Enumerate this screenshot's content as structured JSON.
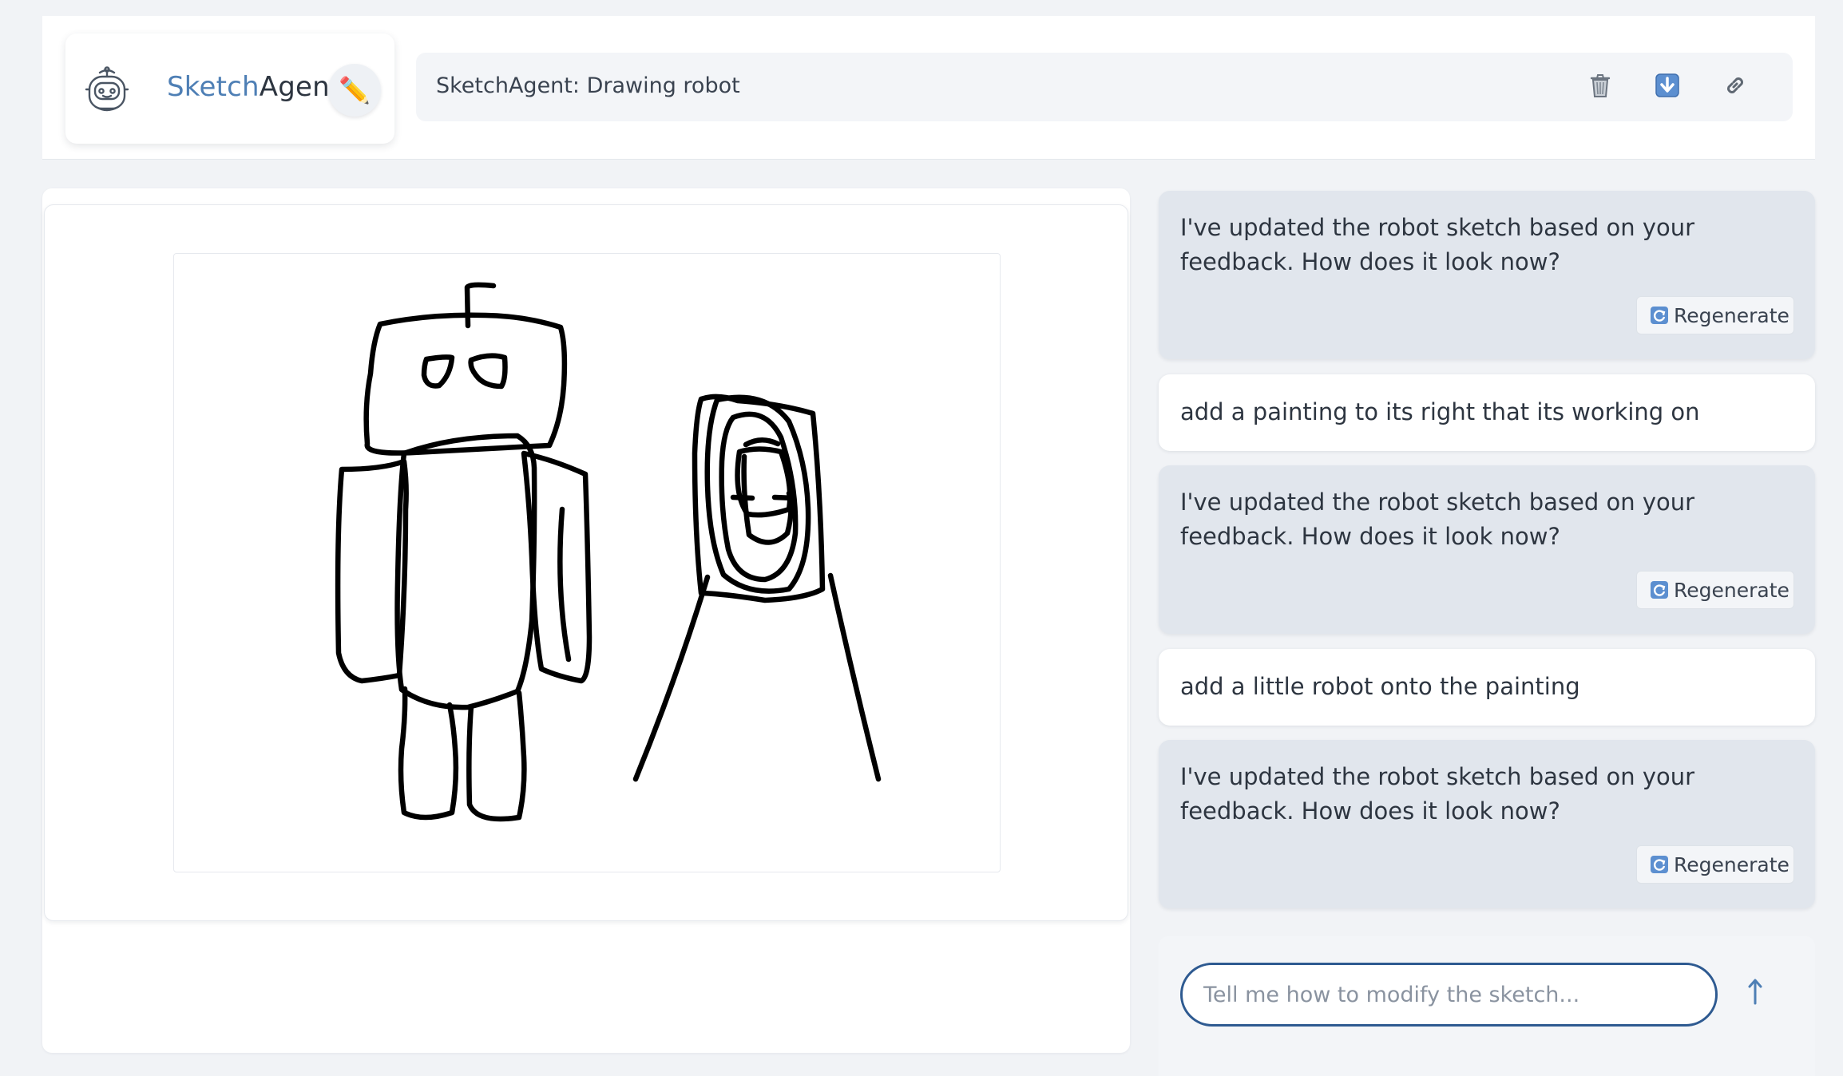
{
  "header": {
    "logo": {
      "part1": "Sketch",
      "part2": "Agent",
      "icon": "robot-icon"
    },
    "edit_icon": "pencil-icon",
    "title": "SketchAgent: Drawing robot",
    "tools": [
      {
        "name": "trash",
        "icon": "trash-icon"
      },
      {
        "name": "download",
        "icon": "download-icon"
      },
      {
        "name": "link",
        "icon": "link-icon"
      }
    ]
  },
  "canvas": {
    "content": "robot sketch with painting easel"
  },
  "chat": {
    "messages": [
      {
        "role": "agent",
        "text": "I've updated the robot sketch based on your feedback. How does it look now?",
        "regenerate_label": "Regenerate"
      },
      {
        "role": "user",
        "text": "add a painting to its right that its working on"
      },
      {
        "role": "agent",
        "text": "I've updated the robot sketch based on your feedback. How does it look now?",
        "regenerate_label": "Regenerate"
      },
      {
        "role": "user",
        "text": "add a little robot onto the painting"
      },
      {
        "role": "agent",
        "text": "I've updated the robot sketch based on your feedback. How does it look now?",
        "regenerate_label": "Regenerate"
      }
    ],
    "input": {
      "placeholder": "Tell me how to modify the sketch...",
      "value": ""
    },
    "send_icon": "arrow-up-icon"
  },
  "colors": {
    "brand_blue": "#4e7fb5",
    "input_border": "#2e5a91",
    "agent_bubble": "#e1e6ed",
    "user_bubble": "#ffffff",
    "page_bg": "#f1f3f6"
  }
}
